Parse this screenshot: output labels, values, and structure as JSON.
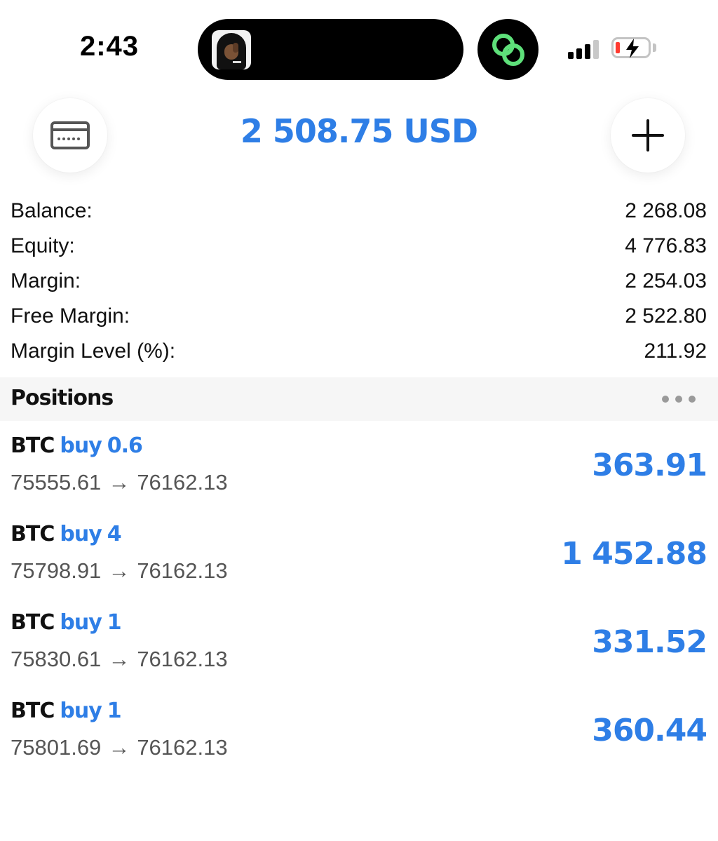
{
  "status_bar": {
    "time": "2:43",
    "live_activity_thumbnail": "hooded-figure-avatar",
    "link_icon": "link-rings-icon",
    "signal_bars": 3,
    "battery_state": "low-charging"
  },
  "header": {
    "left_button_icon": "card-terminal-icon",
    "total": "2 508.75 USD",
    "right_button_icon": "plus-icon"
  },
  "summary": [
    {
      "label": "Balance:",
      "value": "2 268.08"
    },
    {
      "label": "Equity:",
      "value": "4 776.83"
    },
    {
      "label": "Margin:",
      "value": "2 254.03"
    },
    {
      "label": "Free Margin:",
      "value": "2 522.80"
    },
    {
      "label": "Margin Level (%):",
      "value": "211.92"
    }
  ],
  "positions": {
    "title": "Positions",
    "more_icon": "more-horizontal-icon",
    "items": [
      {
        "symbol": "BTC",
        "side": "buy",
        "volume": "0.6",
        "open_price": "75555.61",
        "arrow": "→",
        "current_price": "76162.13",
        "profit": "363.91"
      },
      {
        "symbol": "BTC",
        "side": "buy",
        "volume": "4",
        "open_price": "75798.91",
        "arrow": "→",
        "current_price": "76162.13",
        "profit": "1 452.88"
      },
      {
        "symbol": "BTC",
        "side": "buy",
        "volume": "1",
        "open_price": "75830.61",
        "arrow": "→",
        "current_price": "76162.13",
        "profit": "331.52"
      },
      {
        "symbol": "BTC",
        "side": "buy",
        "volume": "1",
        "open_price": "75801.69",
        "arrow": "→",
        "current_price": "76162.13",
        "profit": "360.44"
      }
    ]
  },
  "colors": {
    "accent_blue": "#2e7ee6",
    "text_primary": "#111111",
    "text_secondary": "#555555",
    "section_bg": "#f6f6f6",
    "link_green": "#5ee07a",
    "battery_red": "#ff3b30"
  }
}
